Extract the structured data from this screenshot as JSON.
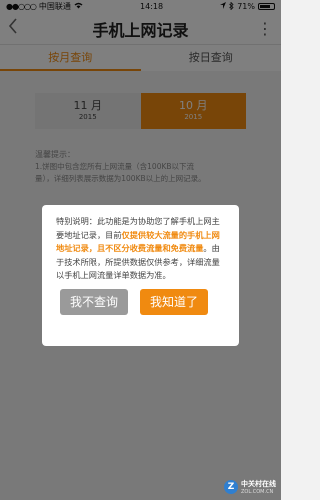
{
  "status_bar": {
    "carrier": "中国联通",
    "signal_icon": "signal-icon",
    "wifi_icon": "wifi-icon",
    "time": "14:18",
    "battery": "71%",
    "battery_level": 0.71
  },
  "navbar": {
    "back_icon": "back-icon",
    "title": "手机上网记录",
    "more_icon": "more-icon"
  },
  "tabs": [
    {
      "label": "按月查询",
      "active": true
    },
    {
      "label": "按日查询",
      "active": false
    }
  ],
  "months": [
    {
      "month": "11 月",
      "year": "2015",
      "selected": false
    },
    {
      "month": "10 月",
      "year": "2015",
      "selected": true
    }
  ],
  "tips": {
    "title": "温馨提示：",
    "lines": [
      "1.饼图中包含您所有上网流量（含100KB以下流",
      "量），详细列表展示数据为100KB以上的上网记录。"
    ]
  },
  "dialog": {
    "text_1": "特别说明：此功能是为协助您了解手机上网主要地址记录，目前",
    "highlight": "仅提供较大流量的手机上网地址记录，且不区分收费流量和免费流量",
    "text_2": "。由于技术所限，所提供数据仅供参考，详细流量以手机上网流量详单数据为准。",
    "cancel_label": "我不查询",
    "ok_label": "我知道了"
  },
  "watermark": {
    "logo": "Z",
    "name": "中关村在线",
    "url": "ZOL.COM.CN"
  },
  "colors": {
    "accent": "#f08a10",
    "cancel": "#9a9a9a"
  }
}
